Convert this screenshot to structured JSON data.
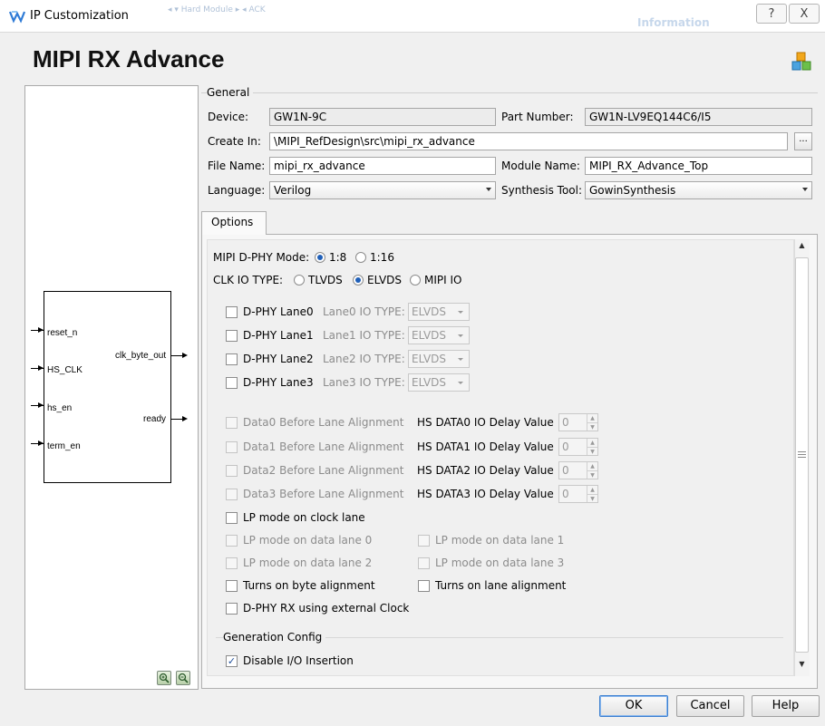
{
  "window": {
    "title": "IP Customization",
    "help_glyph": "?",
    "close_glyph": "X",
    "bg_ghost_left": "◂ ▾ Hard Module   ▸ ◂ ACK",
    "bg_ghost_right": "Information"
  },
  "page_title": "MIPI RX Advance",
  "symbol": {
    "inputs": [
      "reset_n",
      "HS_CLK",
      "hs_en",
      "term_en"
    ],
    "outputs": [
      "clk_byte_out",
      "ready"
    ]
  },
  "general": {
    "title": "General",
    "device_label": "Device:",
    "device_value": "GW1N-9C",
    "part_label": "Part Number:",
    "part_value": "GW1N-LV9EQ144C6/I5",
    "create_in_label": "Create In:",
    "create_in_value": "\\MIPI_RefDesign\\src\\mipi_rx_advance",
    "browse_label": "...",
    "file_name_label": "File Name:",
    "file_name_value": "mipi_rx_advance",
    "module_name_label": "Module Name:",
    "module_name_value": "MIPI_RX_Advance_Top",
    "language_label": "Language:",
    "language_value": "Verilog",
    "synthesis_label": "Synthesis Tool:",
    "synthesis_value": "GowinSynthesis"
  },
  "options": {
    "tab_label": "Options",
    "dphy_mode_label": "MIPI D-PHY Mode:",
    "dphy_mode_options": [
      "1:8",
      "1:16"
    ],
    "dphy_mode_selected": "1:8",
    "clk_io_label": "CLK IO TYPE:",
    "clk_io_options": [
      "TLVDS",
      "ELVDS",
      "MIPI IO"
    ],
    "clk_io_selected": "ELVDS",
    "lanes": [
      {
        "label": "D-PHY Lane0",
        "io_label": "Lane0 IO TYPE:",
        "io_value": "ELVDS"
      },
      {
        "label": "D-PHY Lane1",
        "io_label": "Lane1 IO TYPE:",
        "io_value": "ELVDS"
      },
      {
        "label": "D-PHY Lane2",
        "io_label": "Lane2 IO TYPE:",
        "io_value": "ELVDS"
      },
      {
        "label": "D-PHY Lane3",
        "io_label": "Lane3 IO TYPE:",
        "io_value": "ELVDS"
      }
    ],
    "alignments": [
      {
        "label": "Data0 Before Lane Alignment",
        "delay_label": "HS DATA0 IO Delay Value",
        "delay_value": "0"
      },
      {
        "label": "Data1 Before Lane Alignment",
        "delay_label": "HS DATA1 IO Delay Value",
        "delay_value": "0"
      },
      {
        "label": "Data2 Before Lane Alignment",
        "delay_label": "HS DATA2 IO Delay Value",
        "delay_value": "0"
      },
      {
        "label": "Data3 Before Lane Alignment",
        "delay_label": "HS DATA3 IO Delay Value",
        "delay_value": "0"
      }
    ],
    "lp_clock_lane": "LP mode on clock lane",
    "lp_data_lane0": "LP mode on data lane 0",
    "lp_data_lane1": "LP mode on data lane 1",
    "lp_data_lane2": "LP mode on data lane 2",
    "lp_data_lane3": "LP mode on data lane 3",
    "byte_alignment": "Turns on byte alignment",
    "lane_alignment": "Turns on lane alignment",
    "external_clock": "D-PHY RX using external Clock",
    "gen_config_title": "Generation Config",
    "disable_io_insertion": "Disable I/O Insertion",
    "disable_io_insertion_checked": true
  },
  "buttons": {
    "ok": "OK",
    "cancel": "Cancel",
    "help": "Help"
  },
  "colors": {
    "accent": "#1f5fb8",
    "panel_bg": "#f0f0f0"
  }
}
